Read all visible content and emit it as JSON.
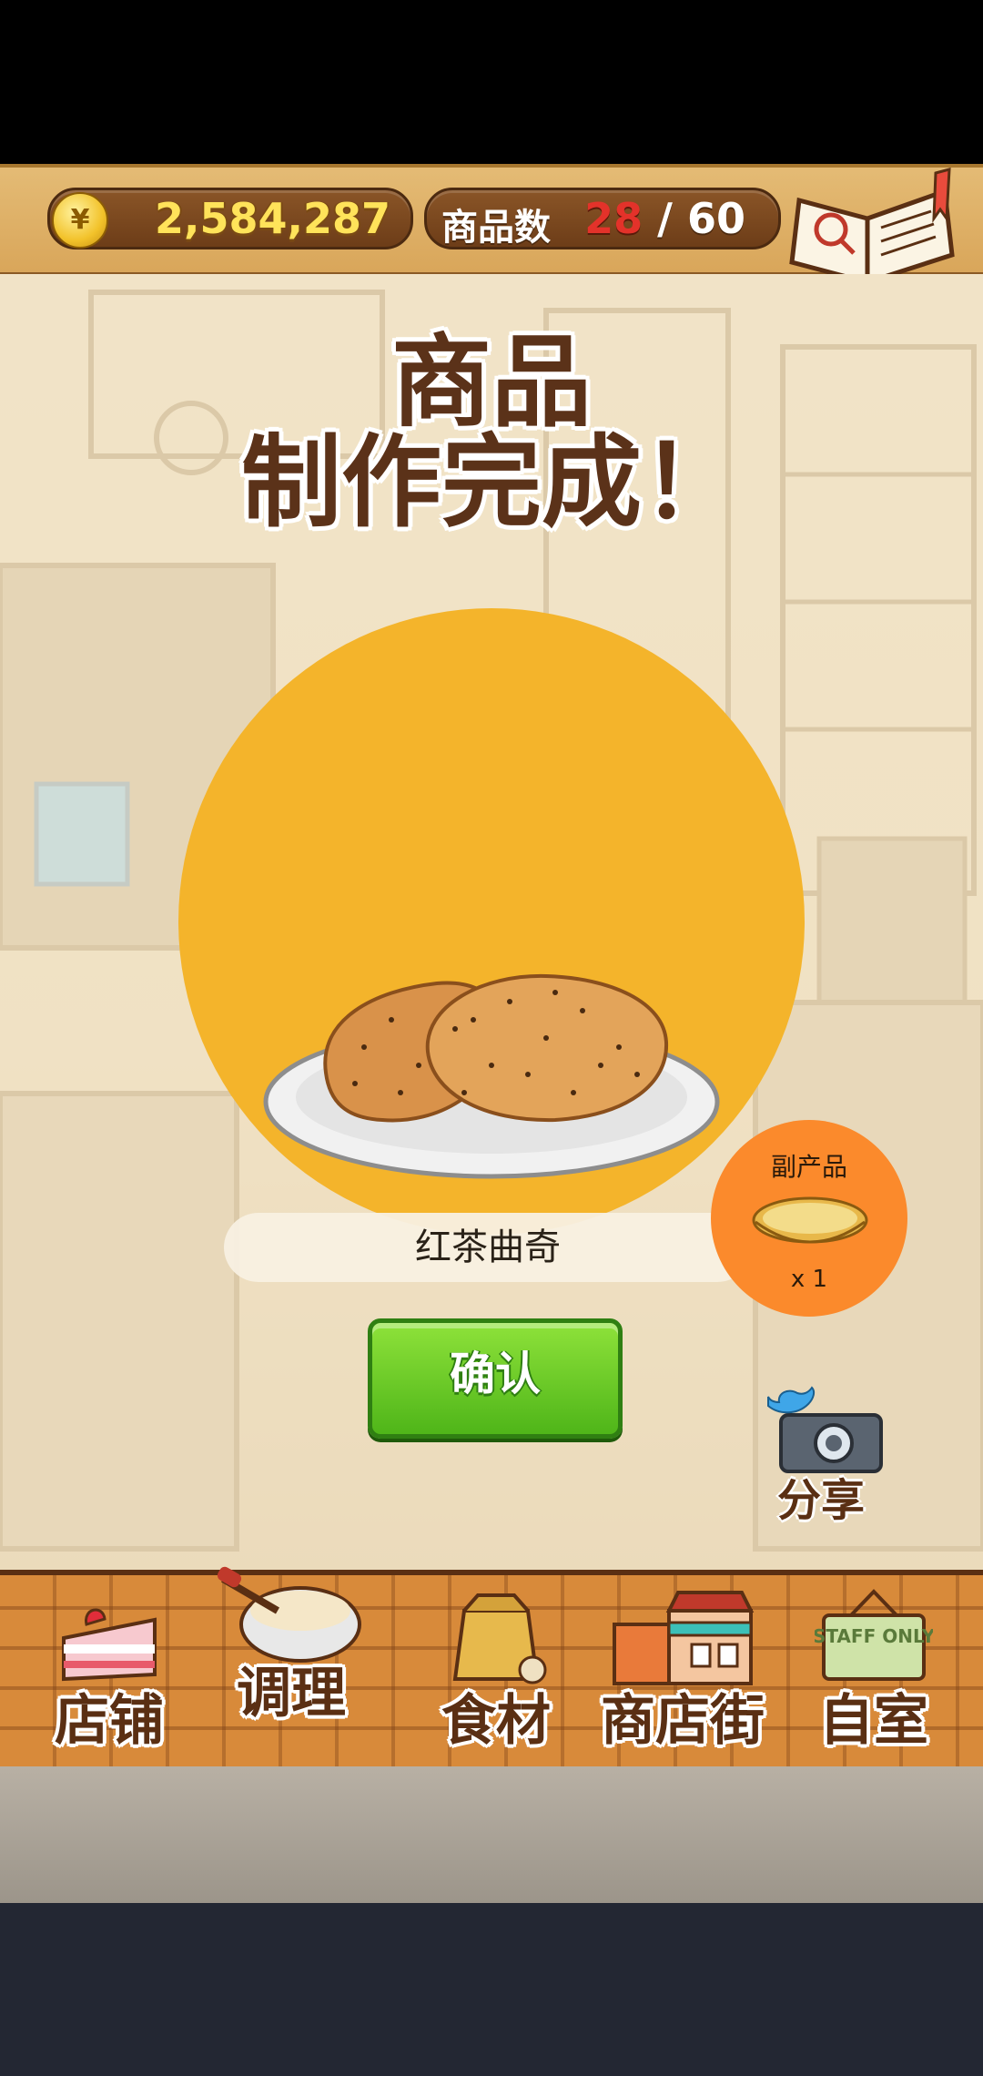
{
  "top_bar": {
    "currency_icon": "¥",
    "money": "2,584,287",
    "goods_label": "商品数",
    "goods_current": "28",
    "goods_separator": "/",
    "goods_max": "60",
    "recipe_label": "食谱"
  },
  "result": {
    "headline_line1": "商品",
    "headline_line2": "制作完成！",
    "product_name": "红茶曲奇",
    "byproduct_label": "副产品",
    "byproduct_qty": "x 1",
    "confirm_label": "确认",
    "share_label": "分享"
  },
  "nav": {
    "items": [
      {
        "label": "店铺",
        "icon": "strawberry-cake-icon"
      },
      {
        "label": "调理",
        "icon": "mixing-bowl-icon"
      },
      {
        "label": "食材",
        "icon": "flour-sack-icon"
      },
      {
        "label": "商店街",
        "icon": "shop-street-icon"
      },
      {
        "label": "自室",
        "icon": "staff-only-sign-icon"
      }
    ],
    "staff_sign_text": "STAFF ONLY"
  },
  "colors": {
    "product_circle": "#f4b42b",
    "byproduct_circle": "#fb8a2c",
    "confirm_button": "#5bc41f",
    "text_brown": "#5a2f13"
  }
}
